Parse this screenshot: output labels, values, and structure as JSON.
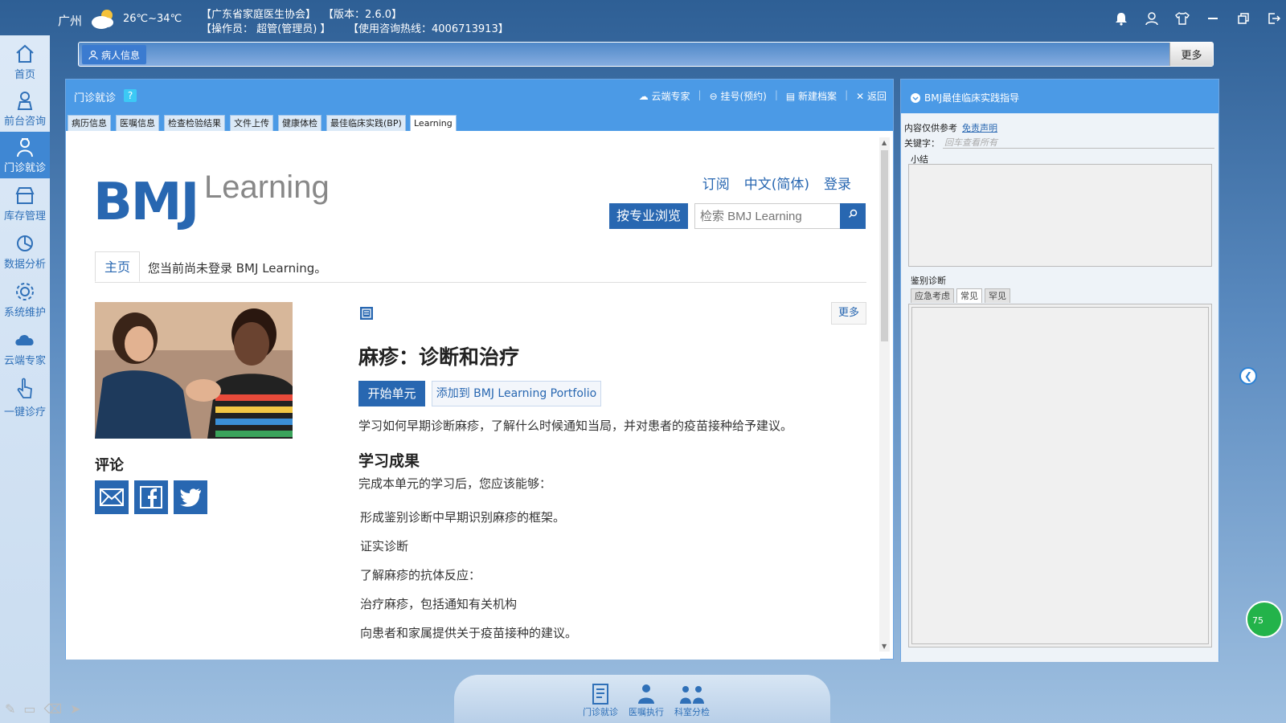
{
  "titlebar": {
    "city": "广州",
    "temperature": "26℃~34℃",
    "association": "【广东省家庭医生协会】",
    "version": "【版本：2.6.0】",
    "operator": "【操作员： 超管(管理员) 】",
    "hotline": "【使用咨询热线：4006713913】"
  },
  "sidebar": {
    "items": [
      {
        "label": "首页",
        "icon": "home-icon"
      },
      {
        "label": "前台咨询",
        "icon": "receptionist-icon"
      },
      {
        "label": "门诊就诊",
        "icon": "doctor-icon"
      },
      {
        "label": "库存管理",
        "icon": "store-icon"
      },
      {
        "label": "数据分析",
        "icon": "chart-icon"
      },
      {
        "label": "系统维护",
        "icon": "gear-icon"
      },
      {
        "label": "云端专家",
        "icon": "cloud-icon"
      },
      {
        "label": "一键诊疗",
        "icon": "hand-pointer-icon"
      }
    ]
  },
  "patient_bar": {
    "tab_label": "病人信息",
    "more_label": "更多"
  },
  "main_panel": {
    "title": "门诊就诊",
    "help": "?",
    "actions": [
      "云端专家",
      "挂号(预约)",
      "新建档案",
      "返回"
    ],
    "tabs": [
      "病历信息",
      "医嘱信息",
      "检查检验结果",
      "文件上传",
      "健康体检",
      "最佳临床实践(BP)",
      "Learning"
    ],
    "active_tab": "Learning"
  },
  "bmj": {
    "logo_bmj": "BMJ",
    "logo_learning": "Learning",
    "links": [
      "订阅",
      "中文(简体)",
      "登录"
    ],
    "browse_button": "按专业浏览",
    "search_placeholder": "检索 BMJ Learning",
    "breadcrumb_home": "主页",
    "login_note": "您当前尚未登录 BMJ Learning。",
    "comment_title": "评论",
    "more_button": "更多",
    "module_title": "麻疹：诊断和治疗",
    "start_button": "开始单元",
    "portfolio_button": "添加到 BMJ Learning Portfolio",
    "module_desc": "学习如何早期诊断麻疹，了解什么时候通知当局，并对患者的疫苗接种给予建议。",
    "outcome_title": "学习成果",
    "outcome_intro": "完成本单元的学习后，您应该能够：",
    "outcomes": [
      "形成鉴别诊断中早期识别麻疹的框架。",
      "证实诊断",
      "了解麻疹的抗体反应：",
      "治疗麻疹，包括通知有关机构",
      "向患者和家属提供关于疫苗接种的建议。"
    ]
  },
  "side_panel": {
    "title": "BMJ最佳临床实践指导",
    "ref_note": "内容仅供参考",
    "disclaimer": "免责声明",
    "keyword_label": "关键字：",
    "keyword_placeholder": "回车查看所有",
    "summary_label": "小结",
    "diff_label": "鉴别诊断",
    "diff_tabs": [
      "应急考虑",
      "常见",
      "罕见"
    ]
  },
  "dock": {
    "items": [
      {
        "label": "门诊就诊",
        "icon": "clipboard-icon"
      },
      {
        "label": "医嘱执行",
        "icon": "nurse-icon"
      },
      {
        "label": "科室分检",
        "icon": "triage-icon"
      }
    ]
  },
  "badge_text": "75"
}
